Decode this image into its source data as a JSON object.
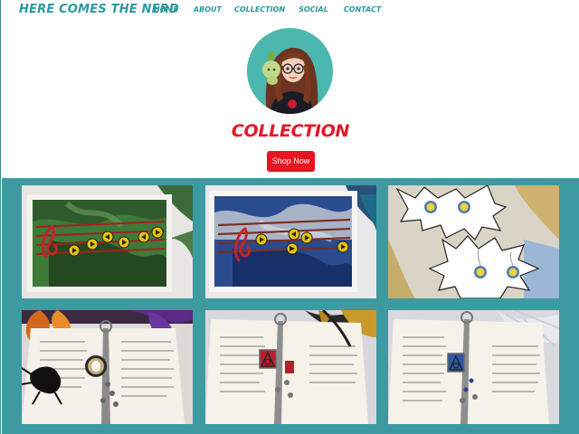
{
  "site": {
    "logo": "HERE COMES THE NERD"
  },
  "nav": {
    "items": [
      {
        "label": "HOME"
      },
      {
        "label": "ABOUT"
      },
      {
        "label": "COLLECTION"
      },
      {
        "label": "SOCIAL"
      },
      {
        "label": "CONTACT"
      }
    ]
  },
  "hero": {
    "title": "COLLECTION",
    "button_label": "Shop Now"
  },
  "colors": {
    "brand_teal": "#2a9aa0",
    "accent_red": "#e8141f",
    "gallery_bg": "#3d9aa0"
  }
}
